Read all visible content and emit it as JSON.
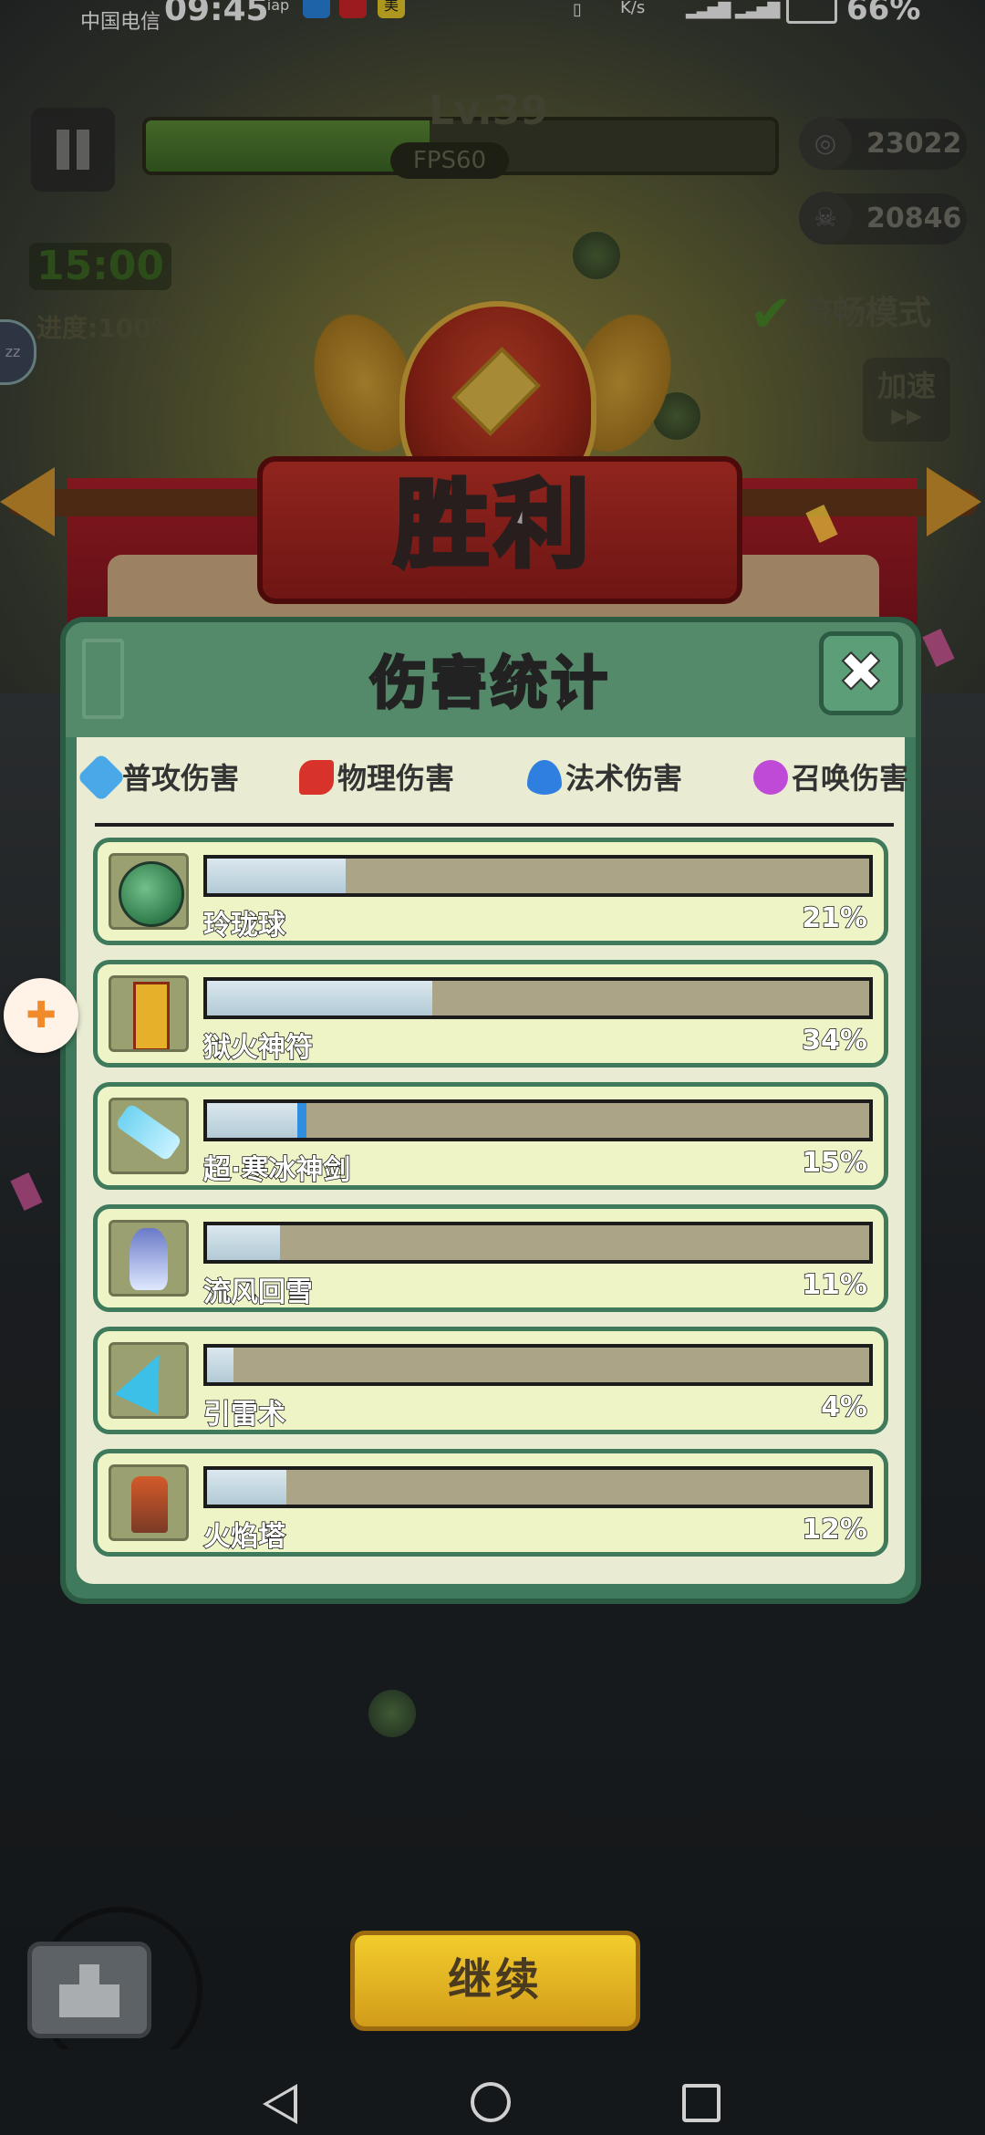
{
  "status_bar": {
    "carrier": "中国电信",
    "time": "09:45",
    "app_badges": [
      "iap",
      "",
      "",
      "美"
    ],
    "net_speed": "K/s",
    "battery": "66%"
  },
  "hud": {
    "level": "Lv.39",
    "level_progress": 0.45,
    "fps": "FPS60",
    "coins": "23022",
    "kills": "20846",
    "timer": "15:00",
    "progress": "进度:100%",
    "smooth_mode": "流畅模式",
    "speed_up": "加速"
  },
  "victory": {
    "title": "胜利"
  },
  "damage_panel": {
    "title": "伤害统计",
    "tabs": [
      {
        "label": "普攻伤害",
        "icon": "sword-icon",
        "color": "#4aa8e8"
      },
      {
        "label": "物理伤害",
        "icon": "claw-icon",
        "color": "#d8332a"
      },
      {
        "label": "法术伤害",
        "icon": "flame-icon",
        "color": "#2f7fe0"
      },
      {
        "label": "召唤伤害",
        "icon": "paw-icon",
        "color": "#c04ad8"
      }
    ],
    "skills": [
      {
        "name": "玲珑球",
        "percent_text": "21%",
        "percent": 21,
        "icon": "jade-ball-icon"
      },
      {
        "name": "狱火神符",
        "percent_text": "34%",
        "percent": 34,
        "icon": "talisman-icon"
      },
      {
        "name": "超·寒冰神剑",
        "percent_text": "15%",
        "percent": 15,
        "icon": "ice-sword-icon"
      },
      {
        "name": "流风回雪",
        "percent_text": "11%",
        "percent": 11,
        "icon": "wind-snow-icon"
      },
      {
        "name": "引雷术",
        "percent_text": "4%",
        "percent": 4,
        "icon": "lightning-icon"
      },
      {
        "name": "火焰塔",
        "percent_text": "12%",
        "percent": 12,
        "icon": "fire-tower-icon"
      }
    ]
  },
  "buttons": {
    "continue": "继续"
  },
  "colors": {
    "panel_green": "#3f7a5c",
    "bar_fill": "#c6d9e2",
    "continue_yellow": "#f2cc2c"
  }
}
